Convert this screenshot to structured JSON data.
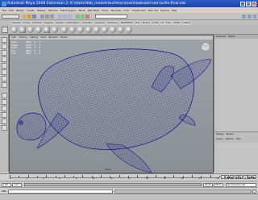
{
  "window": {
    "title": "Autodesk Maya 2008 Extension 2: K:\\sketchfab_models\\turtle\\scenes\\hawksbill-sea-turtle-final.mb",
    "app_icon": "maya-icon",
    "controls": [
      "minimize-icon",
      "maximize-icon",
      "close-icon"
    ]
  },
  "menubar": [
    "File",
    "Edit",
    "Modify",
    "Create",
    "Display",
    "Window",
    "Edit Polygons",
    "Mesh",
    "Edit Mesh",
    "Proxy",
    "Normals",
    "Color",
    "Create UVs",
    "Edit UVs",
    "Muscle",
    "Help"
  ],
  "shelf_tabs": [
    "General",
    "Curves",
    "Surfaces",
    "Polygons",
    "Subdivs",
    "Deformation",
    "Animation",
    "Dynamics",
    "Rendering",
    "PaintEffects",
    "Toon",
    "Muscle",
    "Fluids",
    "Fur",
    "Hair",
    "nCloth",
    "Custom"
  ],
  "viewport": {
    "panel_menu": [
      "View",
      "Shading",
      "Lighting",
      "Show",
      "Renderer",
      "Panels"
    ],
    "hud": [
      {
        "label": "Verts:",
        "a": "3384",
        "b": "0",
        "c": "0"
      },
      {
        "label": "Edges:",
        "a": "6720",
        "b": "0",
        "c": "0"
      },
      {
        "label": "Faces:",
        "a": "3340",
        "b": "0",
        "c": "0"
      },
      {
        "label": "Tris:",
        "a": "6664",
        "b": "0",
        "c": "0"
      },
      {
        "label": "UVs:",
        "a": "3602",
        "b": "0",
        "c": "0"
      }
    ],
    "camera_label": "persp",
    "wire_color": "#1c1c8a",
    "background_color": "#9a9fa6"
  },
  "channel_box": {
    "tabs": [
      "Channels",
      "Object"
    ],
    "layer_tabs": [
      "Display",
      "Render"
    ],
    "layer_menu": [
      "Layers",
      "Options",
      "Help"
    ]
  },
  "timeline": {
    "ticks": [
      "1",
      "2",
      "4",
      "6",
      "8",
      "10",
      "12",
      "14",
      "16",
      "18",
      "20",
      "22",
      "24"
    ],
    "current_frame": "1.00",
    "playback_buttons": [
      "go-to-start-icon",
      "step-back-key-icon",
      "step-back-frame-icon",
      "play-back-icon",
      "play-forward-icon",
      "step-forward-frame-icon",
      "step-forward-key-icon",
      "go-to-end-icon"
    ]
  },
  "range": {
    "start": "1.00",
    "inner_start": "1.00",
    "inner_end": "24.00",
    "end": "48.00",
    "character_set": "No Character Set"
  },
  "command_line": {
    "label": "MEL"
  },
  "help_line": ""
}
